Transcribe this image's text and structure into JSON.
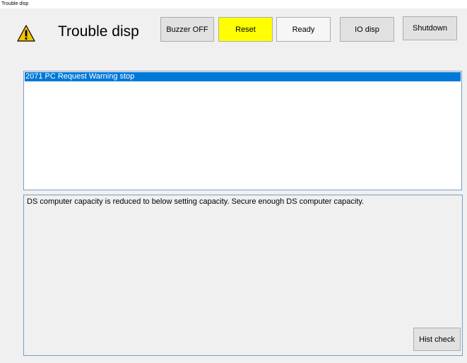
{
  "window": {
    "title": "Trouble disp"
  },
  "header": {
    "title": "Trouble disp",
    "icon": "warning-icon"
  },
  "toolbar": {
    "buzzer_off_label": "Buzzer OFF",
    "reset_label": "Reset",
    "ready_label": "Ready",
    "io_disp_label": "IO disp",
    "shutdown_label": "Shutdown"
  },
  "trouble_list": {
    "items": [
      {
        "text": "2071 PC Request Warning stop",
        "selected": true
      }
    ]
  },
  "detail": {
    "text": "DS computer capacity is reduced to below setting capacity.  Secure enough DS computer capacity."
  },
  "footer": {
    "hist_check_label": "Hist check"
  },
  "colors": {
    "reset_button": "#ffff00",
    "selection": "#0078d7",
    "warning_icon": "#f5c400"
  }
}
